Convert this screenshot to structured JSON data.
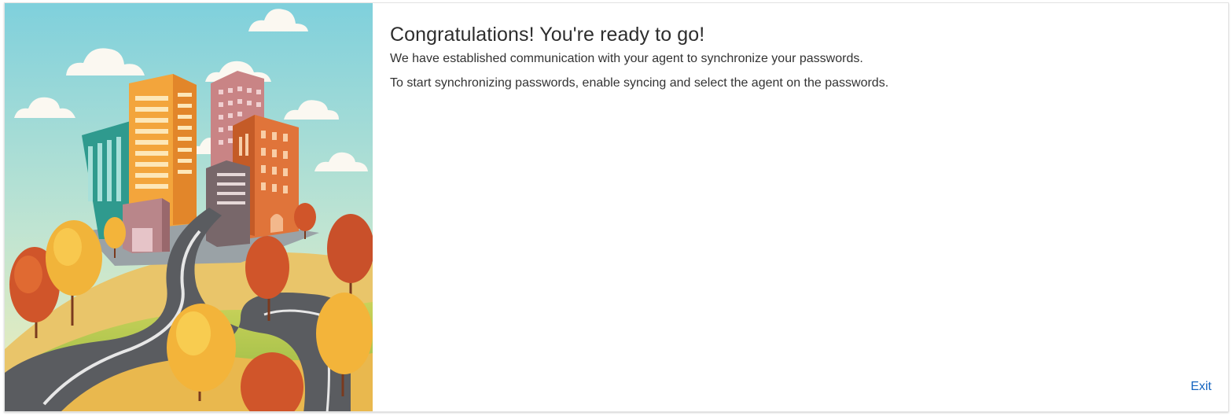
{
  "dialog": {
    "title": "Congratulations! You're ready to go!",
    "line1": "We have established communication with your agent to synchronize your passwords.",
    "line2": "To start synchronizing passwords, enable syncing and select the agent on the passwords.",
    "exit_label": "Exit"
  },
  "colors": {
    "accent_link": "#1565c0",
    "title_text": "#2d2d2d",
    "body_text": "#333333"
  },
  "illustration": {
    "name": "city-road-autumn-illustration"
  }
}
